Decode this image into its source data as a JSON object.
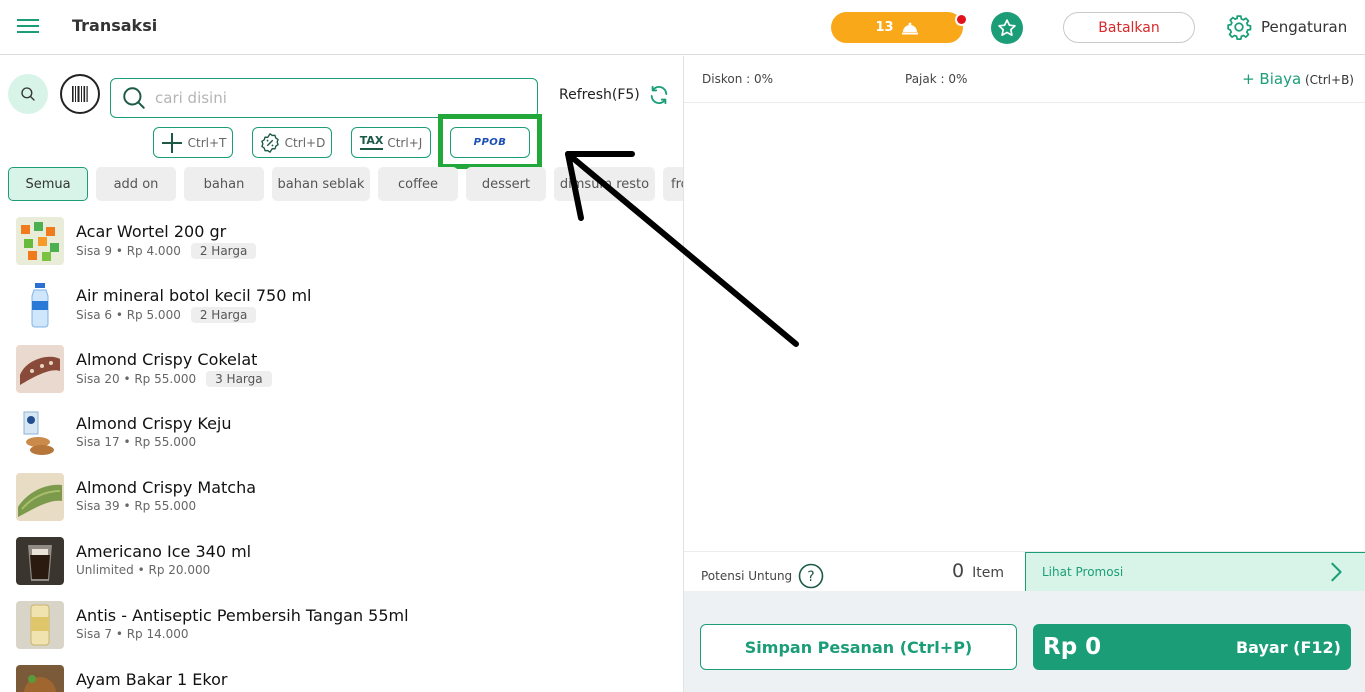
{
  "header": {
    "title": "Transaksi",
    "order_count": "13",
    "cancel_label": "Batalkan",
    "settings_label": "Pengaturan"
  },
  "toolbar": {
    "search_placeholder": "cari disini",
    "refresh_label": "Refresh(F5)",
    "shortcuts": [
      {
        "icon": "plus-icon",
        "label": "Ctrl+T"
      },
      {
        "icon": "discount-badge-icon",
        "label": "Ctrl+D"
      },
      {
        "icon": "tax-icon",
        "icon_text": "TAX",
        "label": "Ctrl+J"
      },
      {
        "icon": "ppob-logo",
        "label": "PPOB"
      }
    ]
  },
  "categories": [
    "Semua",
    "add on",
    "bahan",
    "bahan seblak",
    "coffee",
    "dessert",
    "dimsum resto",
    "fro"
  ],
  "products": [
    {
      "name": "Acar Wortel 200 gr",
      "meta": "Sisa 9 • Rp 4.000",
      "tag": "2 Harga"
    },
    {
      "name": "Air mineral botol kecil 750 ml",
      "meta": "Sisa 6 • Rp 5.000",
      "tag": "2 Harga"
    },
    {
      "name": "Almond Crispy Cokelat",
      "meta": "Sisa 20 • Rp 55.000",
      "tag": "3 Harga"
    },
    {
      "name": "Almond Crispy Keju",
      "meta": "Sisa 17 • Rp 55.000",
      "tag": ""
    },
    {
      "name": "Almond Crispy Matcha",
      "meta": "Sisa 39 • Rp 55.000",
      "tag": ""
    },
    {
      "name": "Americano Ice 340 ml",
      "meta": "Unlimited • Rp 20.000",
      "tag": ""
    },
    {
      "name": "Antis - Antiseptic Pembersih Tangan  55ml",
      "meta": "Sisa 7 • Rp 14.000",
      "tag": ""
    },
    {
      "name": "Ayam Bakar  1 Ekor",
      "meta": "",
      "tag": ""
    }
  ],
  "cart": {
    "diskon": "Diskon : 0%",
    "pajak": "Pajak : 0%",
    "biaya_label": "+ Biaya",
    "biaya_shortcut": "(Ctrl+B)",
    "potensi_label": "Potensi Untung",
    "item_count": "0",
    "item_label": "Item",
    "promo_label": "Lihat Promosi",
    "save_label": "Simpan Pesanan (Ctrl+P)",
    "total": "Rp 0",
    "pay_label": "Bayar (F12)"
  },
  "colors": {
    "accent": "#1b9e78",
    "order_pill": "#f9a81a",
    "cancel_text": "#d92a2a",
    "highlight": "#22a83a"
  }
}
